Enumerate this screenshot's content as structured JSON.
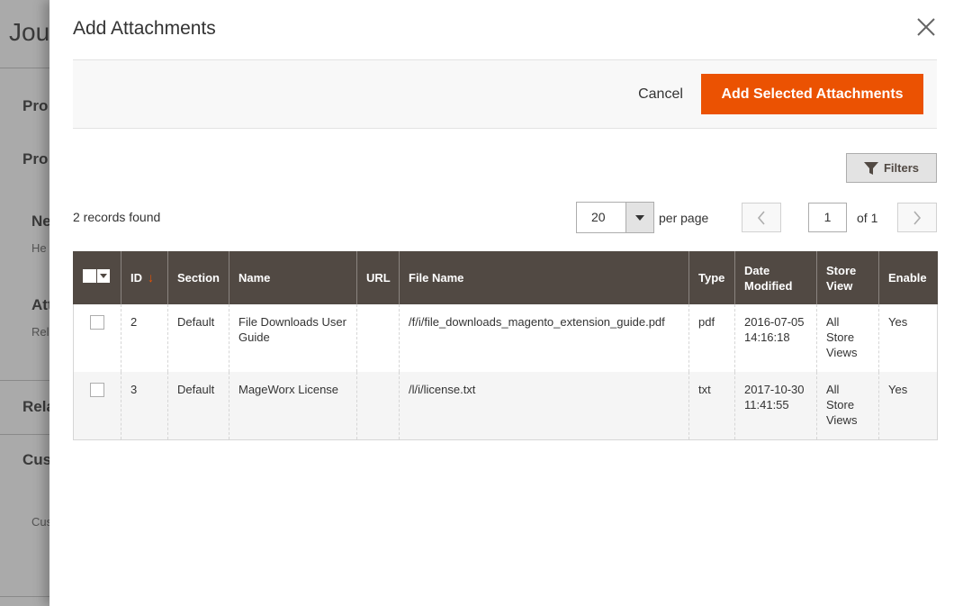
{
  "background": {
    "title": "Jous",
    "headings": [
      "Pro",
      "Pro",
      "Ne",
      "He",
      "Att",
      "Rel",
      "Rela",
      "Cus",
      "Cus"
    ]
  },
  "modal": {
    "title": "Add Attachments",
    "cancel_label": "Cancel",
    "add_label": "Add Selected Attachments",
    "filters_label": "Filters"
  },
  "toolbar": {
    "records_found": "2 records found",
    "per_page_value": "20",
    "per_page_label": "per page",
    "current_page": "1",
    "of_pages": "of 1"
  },
  "grid": {
    "columns": [
      "ID",
      "Section",
      "Name",
      "URL",
      "File Name",
      "Type",
      "Date Modified",
      "Store View",
      "Enable"
    ],
    "rows": [
      {
        "id": "2",
        "section": "Default",
        "name": "File Downloads User Guide",
        "url": "",
        "file_name": "/f/i/file_downloads_magento_extension_guide.pdf",
        "type": "pdf",
        "date": "2016-07-05 14:16:18",
        "store_view": "All Store Views",
        "enable": "Yes"
      },
      {
        "id": "3",
        "section": "Default",
        "name": "MageWorx License",
        "url": "",
        "file_name": "/l/i/license.txt",
        "type": "txt",
        "date": "2017-10-30 11:41:55",
        "store_view": "All Store Views",
        "enable": "Yes"
      }
    ]
  },
  "colors": {
    "accent": "#eb5202",
    "header_bg": "#514943"
  },
  "icons": {
    "close": "close-icon",
    "filter": "funnel-icon",
    "prev": "chevron-left-icon",
    "next": "chevron-right-icon",
    "sort": "arrow-down-icon"
  }
}
